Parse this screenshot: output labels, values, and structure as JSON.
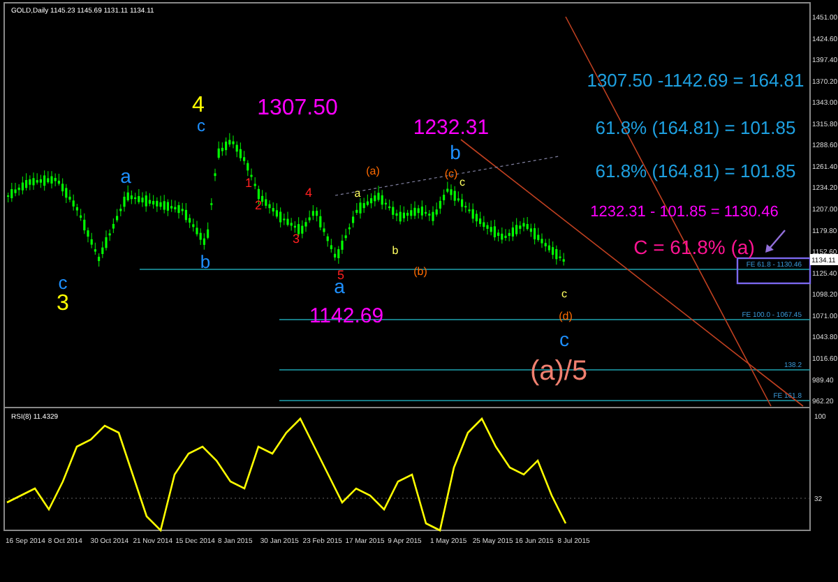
{
  "chart": {
    "header": "GOLD,Daily 1145.23 1145.69 1131.11 1134.11",
    "price_axis": [
      "1451.00",
      "1424.60",
      "1397.40",
      "1370.20",
      "1343.00",
      "1315.80",
      "1288.60",
      "1261.40",
      "1234.20",
      "1207.00",
      "1179.80",
      "1152.60",
      "1125.40",
      "1098.20",
      "1071.00",
      "1043.80",
      "1016.60",
      "989.40",
      "962.20"
    ],
    "current_price": "1134.11",
    "fib_levels": [
      {
        "label": "FE 61.8 - 1130.46"
      },
      {
        "label": "FE 100.0 - 1067.45"
      },
      {
        "label": "138.2"
      },
      {
        "label": "FE 161.8"
      }
    ],
    "annotations": [
      {
        "text": "4",
        "color": "#ffff00"
      },
      {
        "text": "c",
        "color": "#1e90ff"
      },
      {
        "text": "1307.50",
        "color": "#ff00ff"
      },
      {
        "text": "1232.31",
        "color": "#ff00ff"
      },
      {
        "text": "b",
        "color": "#1e90ff"
      },
      {
        "text": "a",
        "color": "#1e90ff"
      },
      {
        "text": "b",
        "color": "#1e90ff"
      },
      {
        "text": "c",
        "color": "#1e90ff"
      },
      {
        "text": "3",
        "color": "#ffff00"
      },
      {
        "text": "a",
        "color": "#1e90ff"
      },
      {
        "text": "1142.69",
        "color": "#ff00ff"
      },
      {
        "text": "c",
        "color": "#1e90ff"
      },
      {
        "text": "(a)/5",
        "color": "#f08070"
      },
      {
        "text": "1307.50 -1142.69 = 164.81",
        "color": "#1ea0e0"
      },
      {
        "text": "61.8% (164.81) = 101.85",
        "color": "#1ea0e0"
      },
      {
        "text": "61.8% (164.81) = 101.85",
        "color": "#1ea0e0"
      },
      {
        "text": "1232.31 - 101.85 = 1130.46",
        "color": "#ff00ff"
      },
      {
        "text": "C = 61.8% (a)",
        "color": "#ff1493"
      },
      {
        "text": "1",
        "color": "#ff2020"
      },
      {
        "text": "2",
        "color": "#ff2020"
      },
      {
        "text": "3",
        "color": "#ff2020"
      },
      {
        "text": "4",
        "color": "#ff2020"
      },
      {
        "text": "5",
        "color": "#ff2020"
      },
      {
        "text": "(a)",
        "color": "#ff6a00"
      },
      {
        "text": "(c)",
        "color": "#ff6a00"
      },
      {
        "text": "(b)",
        "color": "#ff6a00"
      },
      {
        "text": "(d)",
        "color": "#ff6a00"
      },
      {
        "text": "a",
        "color": "#ffff60"
      },
      {
        "text": "c",
        "color": "#ffff60"
      },
      {
        "text": "b",
        "color": "#ffff60"
      },
      {
        "text": "c",
        "color": "#ffff60"
      }
    ]
  },
  "rsi": {
    "header": "RSI(8) 11.4329",
    "axis": [
      "100",
      "32"
    ]
  },
  "date_axis": [
    "16 Sep 2014",
    "8 Oct 2014",
    "30 Oct 2014",
    "21 Nov 2014",
    "15 Dec 2014",
    "8 Jan 2015",
    "30 Jan 2015",
    "23 Feb 2015",
    "17 Mar 2015",
    "9 Apr 2015",
    "1 May 2015",
    "25 May 2015",
    "16 Jun 2015",
    "8 Jul 2015"
  ]
}
